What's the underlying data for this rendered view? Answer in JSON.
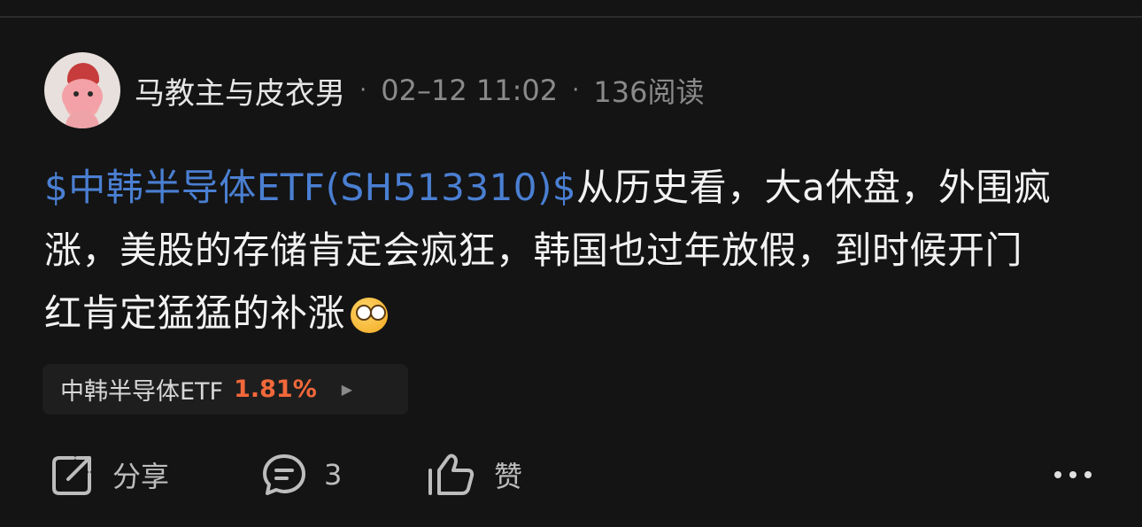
{
  "post": {
    "author": "马教主与皮衣男",
    "separator": "·",
    "time": "02–12 11:02",
    "reads": "136阅读",
    "ticker_link": "$中韩半导体ETF(SH513310)$",
    "body_text": "从历史看，大a休盘，外围疯涨，美股的存储肯定会疯狂，韩国也过年放假，到时候开门红肯定猛猛的补涨",
    "emoji": "666-thinking-emoji",
    "emoji_tag": "666"
  },
  "stock": {
    "name": "中韩半导体ETF",
    "change": "1.81%",
    "arrow": "▶",
    "change_color": "#f2683a"
  },
  "actions": {
    "share_label": "分享",
    "comment_count": "3",
    "like_label": "赞",
    "more": "•••"
  },
  "colors": {
    "background": "#141414",
    "link": "#4a7fd2",
    "meta": "#8a8a8a"
  }
}
